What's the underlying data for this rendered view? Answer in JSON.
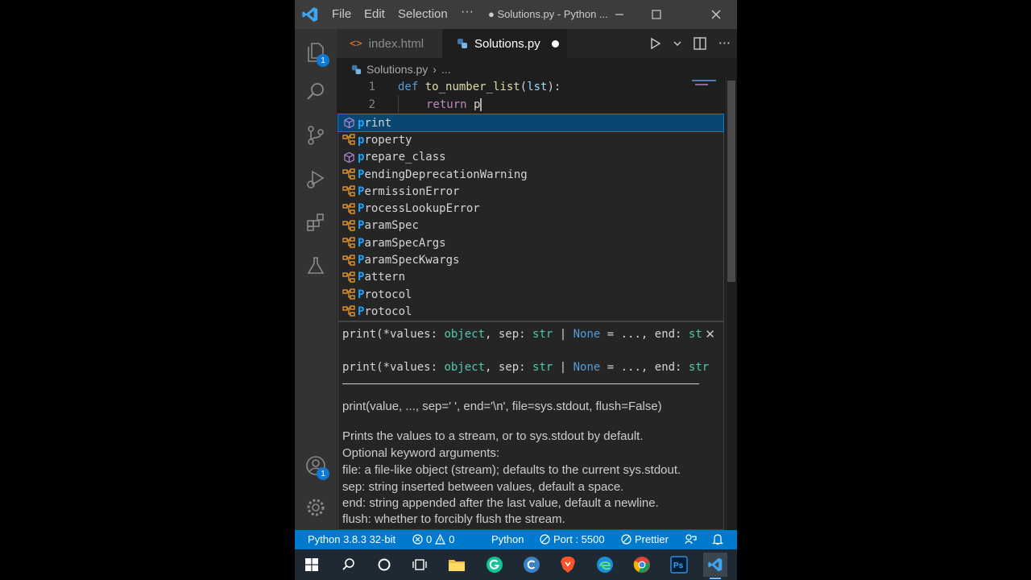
{
  "titlebar": {
    "menus": [
      "File",
      "Edit",
      "Selection",
      "···"
    ],
    "window_title": "● Solutions.py - Python ..."
  },
  "activity": {
    "explorer_badge": "1",
    "account_badge": "1"
  },
  "tabs": [
    {
      "label": "index.html",
      "icon": "html-file-icon"
    },
    {
      "label": "Solutions.py",
      "icon": "python-file-icon",
      "dirty": true
    }
  ],
  "breadcrumb": {
    "file": "Solutions.py",
    "more": "..."
  },
  "editor": {
    "lines": [
      {
        "num": "1",
        "kw": "def",
        "fn": "to_number_list",
        "param": "lst",
        "rest": "):"
      },
      {
        "num": "2",
        "kw": "return",
        "typed": "p"
      }
    ]
  },
  "suggest": {
    "items": [
      {
        "prefix": "p",
        "rest": "rint",
        "kind": "method-icon"
      },
      {
        "prefix": "p",
        "rest": "roperty",
        "kind": "class-icon"
      },
      {
        "prefix": "p",
        "rest": "repare_class",
        "kind": "method-icon"
      },
      {
        "prefix": "P",
        "rest": "endingDeprecationWarning",
        "kind": "class-icon"
      },
      {
        "prefix": "P",
        "rest": "ermissionError",
        "kind": "class-icon"
      },
      {
        "prefix": "P",
        "rest": "rocessLookupError",
        "kind": "class-icon"
      },
      {
        "prefix": "P",
        "rest": "aramSpec",
        "kind": "class-icon"
      },
      {
        "prefix": "P",
        "rest": "aramSpecArgs",
        "kind": "class-icon"
      },
      {
        "prefix": "P",
        "rest": "aramSpecKwargs",
        "kind": "class-icon"
      },
      {
        "prefix": "P",
        "rest": "attern",
        "kind": "class-icon"
      },
      {
        "prefix": "P",
        "rest": "rotocol",
        "kind": "class-icon"
      },
      {
        "prefix": "P",
        "rest": "rotocol",
        "kind": "class-icon"
      }
    ]
  },
  "details": {
    "signature_short": {
      "a": "print(*values: ",
      "t1": "object",
      "b": ", sep: ",
      "t2": "str",
      "c": " | ",
      "n1": "None",
      "d": " = ..., end: ",
      "t3": "st"
    },
    "signature_full": {
      "a": "print(*values: ",
      "t1": "object",
      "b": ", sep: ",
      "t2": "str",
      "c": " | ",
      "n1": "None",
      "d": " = ..., end: ",
      "t3": "str"
    },
    "doc_signature": "print(value, ..., sep=' ', end='\\n', file=sys.stdout, flush=False)",
    "doc_lines": [
      "Prints the values to a stream, or to sys.stdout by default.",
      "Optional keyword arguments:",
      "file: a file-like object (stream); defaults to the current sys.stdout.",
      "sep: string inserted between values, default a space.",
      "end: string appended after the last value, default a newline.",
      "flush: whether to forcibly flush the stream."
    ]
  },
  "statusbar": {
    "interpreter": "Python 3.8.3 32-bit",
    "errors": "0",
    "warnings": "0",
    "language": "Python",
    "port": "Port : 5500",
    "prettier": "Prettier"
  },
  "colors": {
    "accent": "#007acc",
    "selection": "#094771",
    "match": "#18a3ff"
  }
}
